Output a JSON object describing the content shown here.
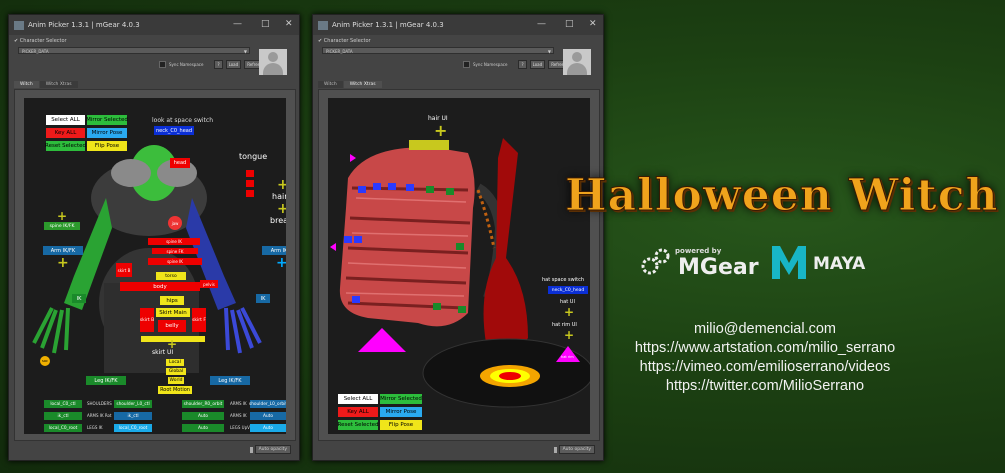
{
  "windows": [
    {
      "title": "Anim Picker 1.3.1 | mGear 4.0.3",
      "char_label": "Character Selector",
      "selected": "PICKER_DATA",
      "sync": "Sync Namespace",
      "q": "?",
      "load": "Load",
      "refresh": "Refresh",
      "tabs": [
        "Witch",
        "Witch Xtras"
      ],
      "active_tab": 0,
      "auto": "Auto opacity"
    },
    {
      "title": "Anim Picker 1.3.1 | mGear 4.0.3",
      "char_label": "Character Selector",
      "selected": "PICKER_DATA",
      "sync": "Sync Namespace",
      "q": "?",
      "load": "Load",
      "refresh": "Refresh",
      "tabs": [
        "Witch",
        "Witch Xtras"
      ],
      "active_tab": 1,
      "auto": "Auto opacity"
    }
  ],
  "p1": {
    "select_all": "Select ALL",
    "mirror_selected": "Mirror Selected",
    "key_all": "Key ALL",
    "mirror_pose": "Mirror Pose",
    "reset_selected": "Reset Selected",
    "flip_pose": "Flip Pose",
    "look_at": "look at space switch",
    "neck": "neck_C0_head",
    "tongue": "tongue",
    "hair_ui": "hair UI",
    "breast_ui": "breast UI",
    "spine": "spine IK/FK",
    "arm_l": "Arm IK/FK",
    "arm_r": "Arm IK/FK",
    "head": "head",
    "jaw": "jaw",
    "spine_ik": "spine IK",
    "spine_fk": "spine FK",
    "spine_top": "spine IK",
    "skirt_b": "skirt B",
    "pelvis": "pelvis",
    "torso": "torso",
    "body": "body",
    "hips": "hips",
    "skirt_main": "Skirt Main",
    "skirt_l": "skirt B",
    "skirt_r": "skirt F",
    "belly": "belly",
    "ik_l": "IK",
    "ik_r": "IK",
    "skirt_ui": "skirt UI",
    "local": "Local",
    "global": "Global",
    "world": "World",
    "root": "Root Motion",
    "leg_l": "Leg IK/FK",
    "leg_r": "Leg IK/FK",
    "soc_l": "soc",
    "soc_r": "soc",
    "rows": [
      [
        "local_C0_ctl",
        "SHOULDERS",
        "shoulder_L0_ctl",
        "shoulder_R0_orbit",
        "ARMS IK",
        "shoulder_L0_orbit"
      ],
      [
        "ik_ctl",
        "ARMS IK Rot",
        "ik_ctl",
        "Auto",
        "ARMS IK",
        "Auto"
      ],
      [
        "local_C0_root",
        "LEGS IK",
        "local_C0_root",
        "Auto",
        "LEGS UpV",
        "Auto"
      ]
    ]
  },
  "p2": {
    "hair_ui": "hair UI",
    "hat_switch": "hat space switch",
    "neck": "neck_C0_head",
    "hat_ui": "hat UI",
    "bottom_ui": "hat rim UI",
    "hat_tag": "hat rim",
    "select_all": "Select ALL",
    "mirror_selected": "Mirror Selected",
    "key_all": "Key ALL",
    "mirror_pose": "Mirror Pose",
    "reset_selected": "Reset Selected",
    "flip_pose": "Flip Pose"
  },
  "banner": {
    "title": "Halloween Witch",
    "powered_by": "powered by",
    "mgear": "MGear",
    "maya": "MAYA",
    "contact": [
      "milio@demencial.com",
      "https://www.artstation.com/milio_serrano",
      "https://vimeo.com/emilioserrano/videos",
      "https://twitter.com/MilioSerrano"
    ]
  }
}
